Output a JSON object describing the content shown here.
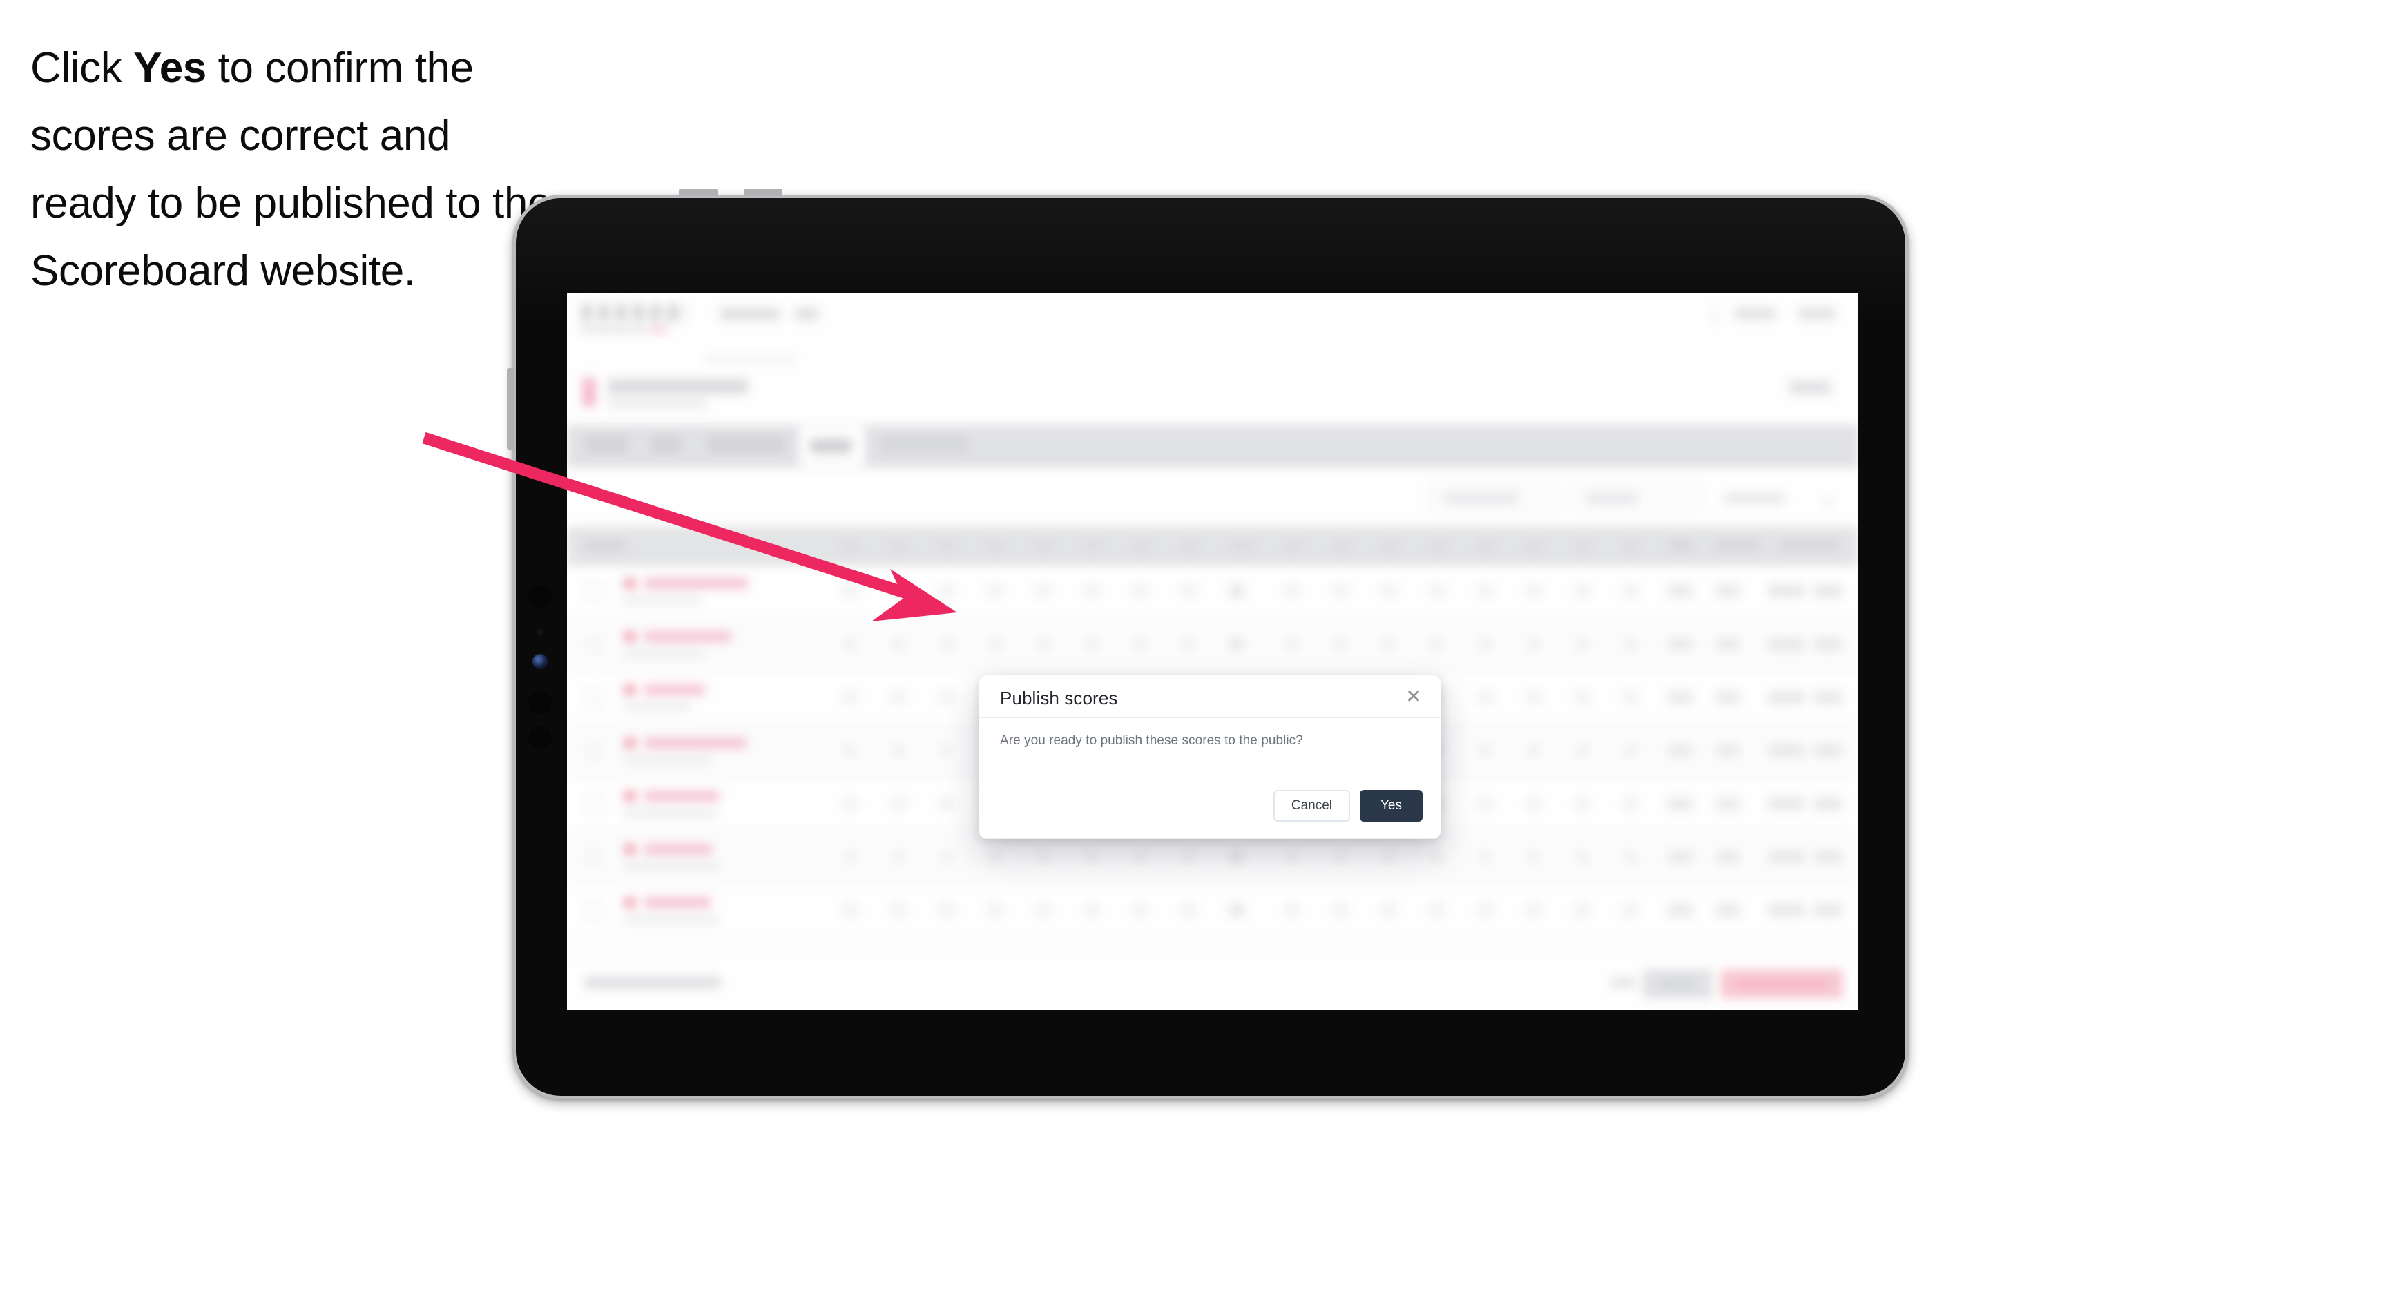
{
  "caption": {
    "part1": "Click ",
    "emphasis": "Yes",
    "part2": " to confirm the scores are correct and ready to be published to the Scoreboard website."
  },
  "device": {
    "type": "tablet",
    "orientation": "landscape"
  },
  "modal": {
    "title": "Publish scores",
    "close_icon": "close-icon",
    "message": "Are you ready to publish these scores to the public?",
    "buttons": {
      "cancel": "Cancel",
      "confirm": "Yes"
    }
  },
  "colors": {
    "arrow": "#ED2760",
    "confirm_button_bg": "#2B3849",
    "confirm_button_text": "#FFFFFF",
    "cancel_button_border": "#DFE6EF",
    "modal_title": "#23262B",
    "modal_text": "#6E747C",
    "tablet_frame": "#B9BABC",
    "tablet_bezel": "#0A0A0A"
  },
  "background_app": {
    "note": "blurred scoreboard application behind the modal",
    "tab_count": 5,
    "table_rows": 7
  }
}
